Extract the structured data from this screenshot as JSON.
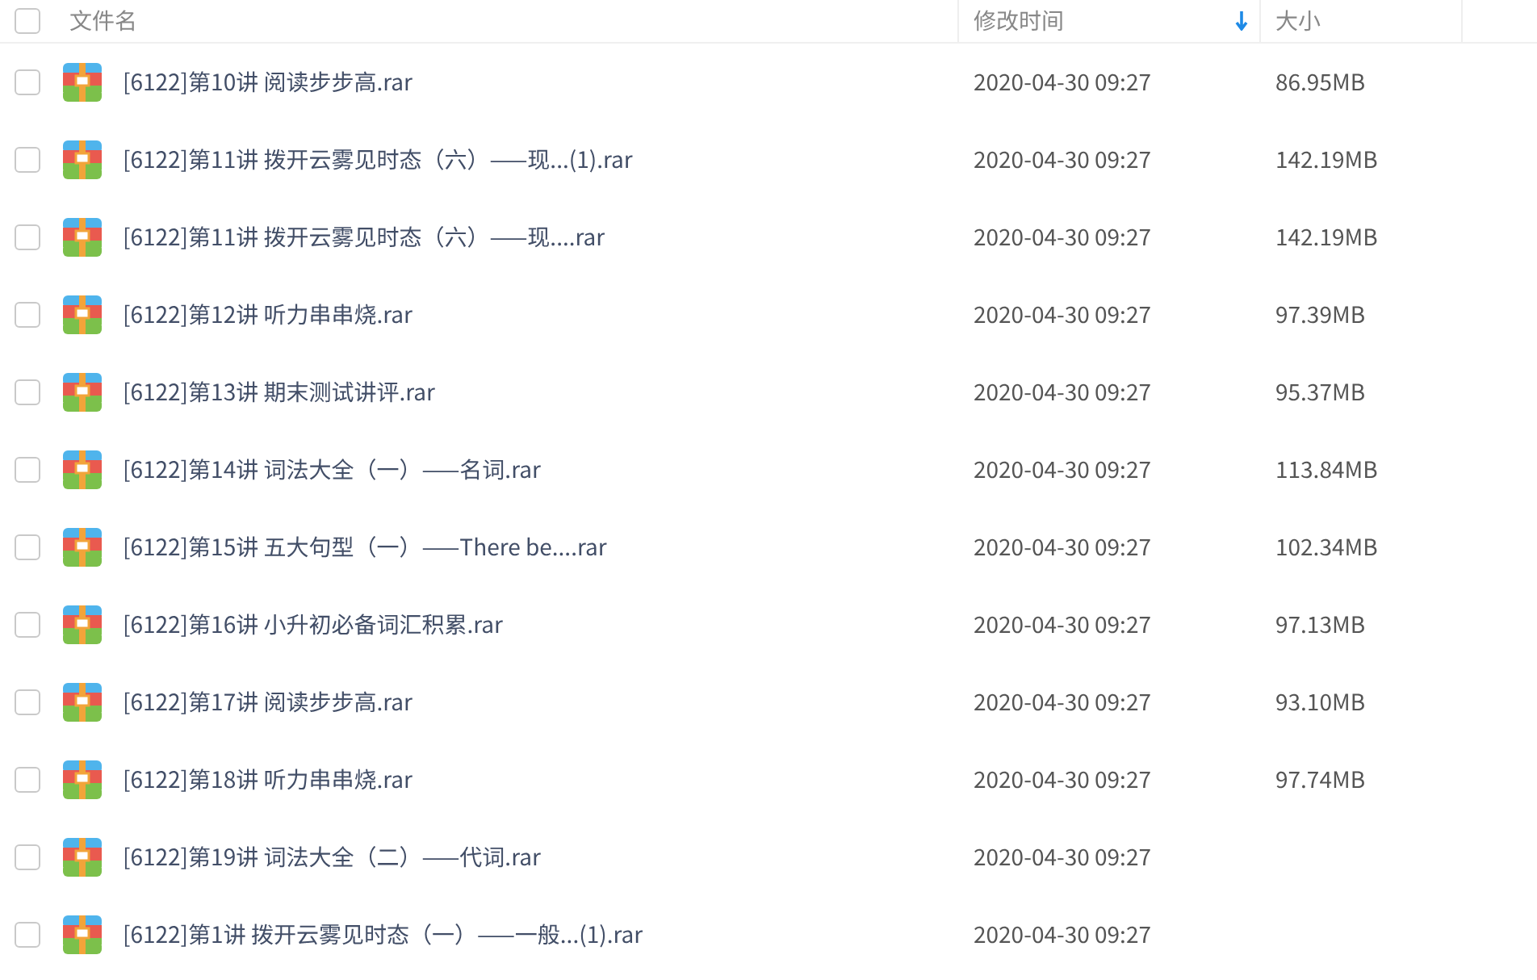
{
  "header": {
    "select_all": {
      "checked": false
    },
    "columns": [
      {
        "label": "文件名",
        "sorted": false
      },
      {
        "label": "修改时间",
        "sorted": true
      },
      {
        "label": "大小",
        "sorted": false
      }
    ]
  },
  "rows": [
    {
      "checked": false,
      "name": "[6122]第10讲 阅读步步高.rar",
      "modified": "2020-04-30 09:27",
      "size": "86.95MB"
    },
    {
      "checked": false,
      "name": "[6122]第11讲 拨开云雾见时态（六）——现...(1).rar",
      "modified": "2020-04-30 09:27",
      "size": "142.19MB"
    },
    {
      "checked": false,
      "name": "[6122]第11讲 拨开云雾见时态（六）——现....rar",
      "modified": "2020-04-30 09:27",
      "size": "142.19MB"
    },
    {
      "checked": false,
      "name": "[6122]第12讲 听力串串烧.rar",
      "modified": "2020-04-30 09:27",
      "size": "97.39MB"
    },
    {
      "checked": false,
      "name": "[6122]第13讲 期末测试讲评.rar",
      "modified": "2020-04-30 09:27",
      "size": "95.37MB"
    },
    {
      "checked": false,
      "name": "[6122]第14讲 词法大全（一）——名词.rar",
      "modified": "2020-04-30 09:27",
      "size": "113.84MB"
    },
    {
      "checked": false,
      "name": "[6122]第15讲 五大句型（一）——There be....rar",
      "modified": "2020-04-30 09:27",
      "size": "102.34MB"
    },
    {
      "checked": false,
      "name": "[6122]第16讲 小升初必备词汇积累.rar",
      "modified": "2020-04-30 09:27",
      "size": "97.13MB"
    },
    {
      "checked": false,
      "name": "[6122]第17讲 阅读步步高.rar",
      "modified": "2020-04-30 09:27",
      "size": "93.10MB"
    },
    {
      "checked": false,
      "name": "[6122]第18讲 听力串串烧.rar",
      "modified": "2020-04-30 09:27",
      "size": "97.74MB"
    },
    {
      "checked": false,
      "name": "[6122]第19讲 词法大全（二）——代词.rar",
      "modified": "2020-04-30 09:27"
    },
    {
      "checked": false,
      "name": "[6122]第1讲 拨开云雾见时态（一）——一般...(1).rar",
      "modified": "2020-04-30 09:27"
    }
  ]
}
